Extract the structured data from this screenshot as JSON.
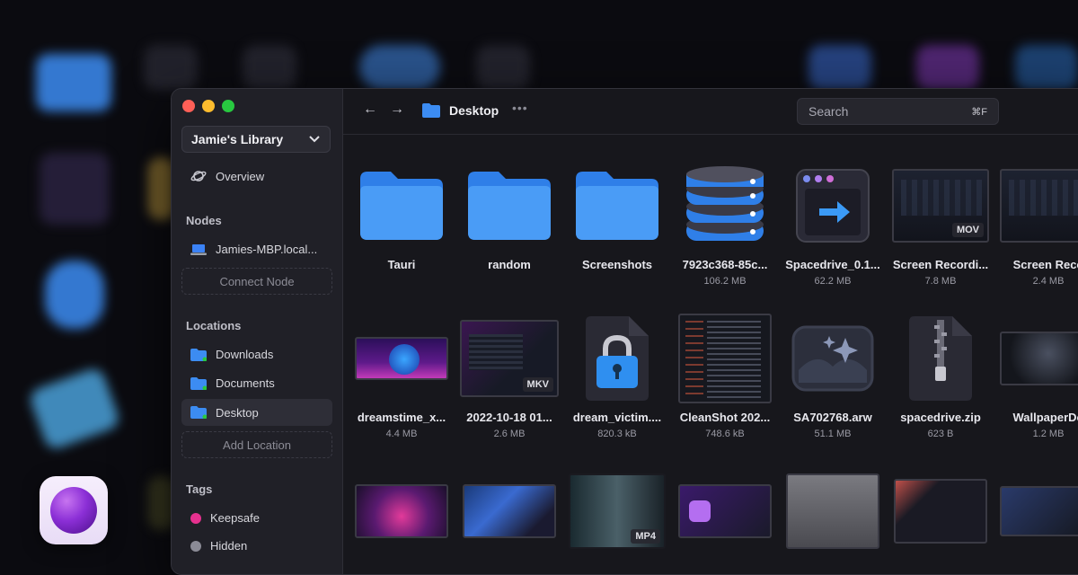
{
  "colors": {
    "accent": "#3b82f6",
    "folder": "#3c8cf2",
    "close": "#ff5f57",
    "minimize": "#febc2e",
    "zoom": "#28c840",
    "tag_keepsafe": "#e6318f",
    "tag_hidden": "#8b8b96"
  },
  "sidebar": {
    "library": "Jamie's Library",
    "overview": "Overview",
    "nodes_heading": "Nodes",
    "node_name": "Jamies-MBP.local...",
    "connect_node": "Connect Node",
    "locations_heading": "Locations",
    "locations": [
      "Downloads",
      "Documents",
      "Desktop"
    ],
    "add_location": "Add Location",
    "tags_heading": "Tags",
    "tags": [
      "Keepsafe",
      "Hidden"
    ]
  },
  "toolbar": {
    "back": "←",
    "forward": "→",
    "path": "Desktop",
    "more": "•••",
    "search_placeholder": "Search",
    "search_shortcut": "⌘F"
  },
  "files": [
    {
      "name": "Tauri",
      "size": ""
    },
    {
      "name": "random",
      "size": ""
    },
    {
      "name": "Screenshots",
      "size": ""
    },
    {
      "name": "7923c368-85c...",
      "size": "106.2 MB"
    },
    {
      "name": "Spacedrive_0.1...",
      "size": "62.2 MB"
    },
    {
      "name": "Screen Recordi...",
      "size": "7.8 MB",
      "badge": "MOV"
    },
    {
      "name": "Screen Reco",
      "size": "2.4 MB"
    },
    {
      "name": "dreamstime_x...",
      "size": "4.4 MB"
    },
    {
      "name": "2022-10-18 01...",
      "size": "2.6 MB",
      "badge": "MKV"
    },
    {
      "name": "dream_victim....",
      "size": "820.3 kB"
    },
    {
      "name": "CleanShot 202...",
      "size": "748.6 kB"
    },
    {
      "name": "SA702768.arw",
      "size": "51.1 MB"
    },
    {
      "name": "spacedrive.zip",
      "size": "623 B"
    },
    {
      "name": "WallpaperDo",
      "size": "1.2 MB"
    },
    {
      "name": "",
      "size": ""
    },
    {
      "name": "",
      "size": ""
    },
    {
      "name": "",
      "size": "",
      "badge": "MP4"
    }
  ]
}
